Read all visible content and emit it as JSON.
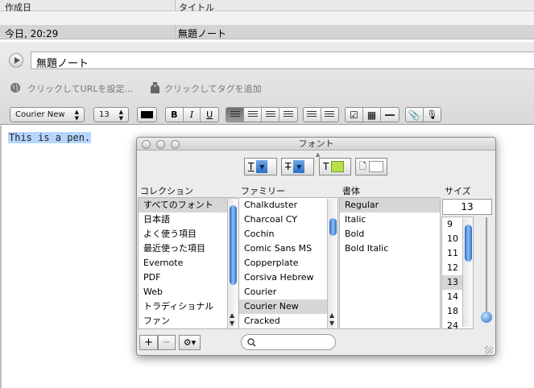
{
  "list_header": {
    "col_created": "作成日",
    "col_title": "タイトル"
  },
  "note_row": {
    "created": "今日, 20:29",
    "title": "無題ノート"
  },
  "editor": {
    "title": "無題ノート",
    "url_placeholder": "クリックしてURLを設定...",
    "tag_placeholder": "クリックしてタグを追加",
    "content": "This is a pen."
  },
  "toolbar": {
    "font": "Courier New",
    "size": "13",
    "bold": "B",
    "italic": "I",
    "underline": "U"
  },
  "fonts_panel": {
    "title": "フォント",
    "headers": {
      "collection": "コレクション",
      "family": "ファミリー",
      "typeface": "書体",
      "size": "サイズ"
    },
    "collections": [
      {
        "label": "すべてのフォント",
        "selected": true
      },
      {
        "label": "日本語"
      },
      {
        "label": "よく使う項目"
      },
      {
        "label": "最近使った項目"
      },
      {
        "label": "Evernote"
      },
      {
        "label": "PDF"
      },
      {
        "label": "Web"
      },
      {
        "label": "トラディショナル"
      },
      {
        "label": "ファン"
      }
    ],
    "families": [
      {
        "label": "Chalkduster"
      },
      {
        "label": "Charcoal CY"
      },
      {
        "label": "Cochin"
      },
      {
        "label": "Comic Sans MS"
      },
      {
        "label": "Copperplate"
      },
      {
        "label": "Corsiva Hebrew"
      },
      {
        "label": "Courier"
      },
      {
        "label": "Courier New",
        "selected": true
      },
      {
        "label": "Cracked"
      }
    ],
    "typefaces": [
      {
        "label": "Regular",
        "selected": true
      },
      {
        "label": "Italic"
      },
      {
        "label": "Bold"
      },
      {
        "label": "Bold Italic"
      }
    ],
    "size_value": "13",
    "sizes": [
      {
        "label": "9"
      },
      {
        "label": "10"
      },
      {
        "label": "11"
      },
      {
        "label": "12"
      },
      {
        "label": "13",
        "selected": true
      },
      {
        "label": "14"
      },
      {
        "label": "18"
      },
      {
        "label": "24"
      }
    ],
    "add_label": "+",
    "remove_label": "−",
    "colors": {
      "text_swatch": "#b6e04a",
      "doc_swatch": "#ffffff",
      "selection": "#b5d5ff"
    }
  }
}
